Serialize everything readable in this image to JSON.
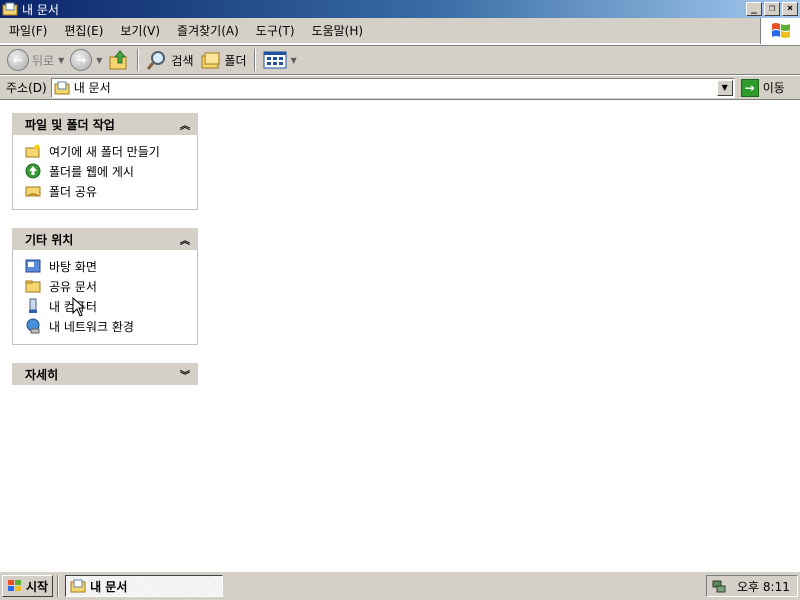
{
  "window": {
    "title": "내 문서",
    "btn_min": "_",
    "btn_restore": "❐",
    "btn_close": "×"
  },
  "menu": [
    "파일(F)",
    "편집(E)",
    "보기(V)",
    "즐겨찾기(A)",
    "도구(T)",
    "도움말(H)"
  ],
  "toolbar": {
    "back": "뒤로",
    "search": "검색",
    "folders": "폴더"
  },
  "address": {
    "label": "주소(D)",
    "value": "내 문서",
    "go": "이동"
  },
  "panels": {
    "file_tasks": {
      "title": "파일 및 폴더 작업",
      "items": [
        "여기에 새 폴더 만들기",
        "폴더를 웹에 게시",
        "폴더 공유"
      ]
    },
    "other_places": {
      "title": "기타 위치",
      "items": [
        "바탕 화면",
        "공유 문서",
        "내 컴퓨터",
        "내 네트워크 환경"
      ]
    },
    "details": {
      "title": "자세히"
    }
  },
  "taskbar": {
    "start": "시작",
    "window": "내 문서",
    "clock": "오후 8:11"
  },
  "icons": {
    "title": "folder-document-icon",
    "back": "back-arrow-icon",
    "forward": "forward-arrow-icon",
    "up": "folder-up-icon",
    "search": "magnifier-icon",
    "folders": "folders-icon",
    "views": "views-icon",
    "go": "go-arrow-icon"
  },
  "colors": {
    "titlebar": "#0a246a",
    "chrome": "#d4d0c8",
    "go": "#2e9a2e"
  }
}
